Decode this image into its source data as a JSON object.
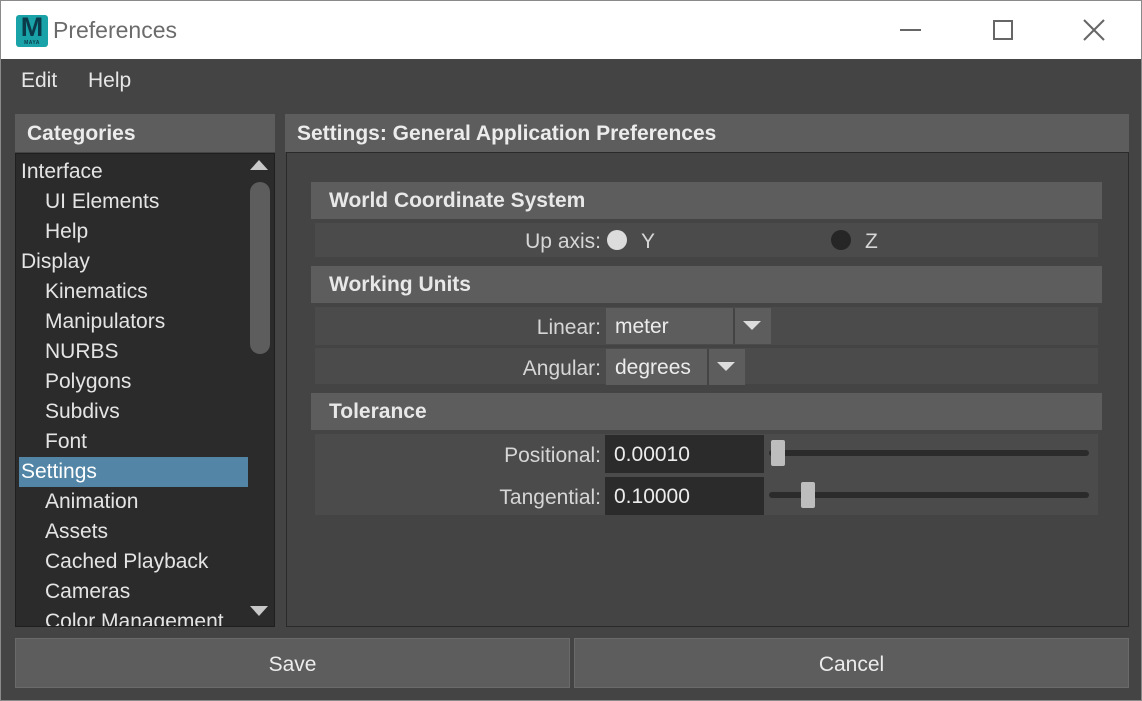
{
  "window": {
    "title": "Preferences",
    "icon_letter": "M",
    "icon_sublabel": "MAYA",
    "icon_color": "#19a3a8",
    "controls": [
      "minimize-icon",
      "maximize-icon",
      "close-icon"
    ]
  },
  "menubar": {
    "items": [
      "Edit",
      "Help"
    ]
  },
  "categories": {
    "header": "Categories",
    "items": [
      {
        "label": "Interface",
        "level": 0
      },
      {
        "label": "UI Elements",
        "level": 1
      },
      {
        "label": "Help",
        "level": 1
      },
      {
        "label": "Display",
        "level": 0
      },
      {
        "label": "Kinematics",
        "level": 1
      },
      {
        "label": "Manipulators",
        "level": 1
      },
      {
        "label": "NURBS",
        "level": 1
      },
      {
        "label": "Polygons",
        "level": 1
      },
      {
        "label": "Subdivs",
        "level": 1
      },
      {
        "label": "Font",
        "level": 1
      },
      {
        "label": "Settings",
        "level": 0,
        "selected": true
      },
      {
        "label": "Animation",
        "level": 1
      },
      {
        "label": "Assets",
        "level": 1
      },
      {
        "label": "Cached Playback",
        "level": 1
      },
      {
        "label": "Cameras",
        "level": 1
      },
      {
        "label": "Color Management",
        "level": 1
      }
    ],
    "selected_color": "#5285a6"
  },
  "settings": {
    "header": "Settings: General Application Preferences",
    "world": {
      "title": "World Coordinate System",
      "up_axis_label": "Up axis:",
      "options": [
        {
          "label": "Y",
          "selected": false
        },
        {
          "label": "Z",
          "selected": true
        }
      ]
    },
    "units": {
      "title": "Working Units",
      "linear_label": "Linear:",
      "linear_value": "meter",
      "angular_label": "Angular:",
      "angular_value": "degrees"
    },
    "tolerance": {
      "title": "Tolerance",
      "positional_label": "Positional:",
      "positional_value": "0.00010",
      "tangential_label": "Tangential:",
      "tangential_value": "0.10000"
    }
  },
  "buttons": {
    "save": "Save",
    "cancel": "Cancel"
  }
}
